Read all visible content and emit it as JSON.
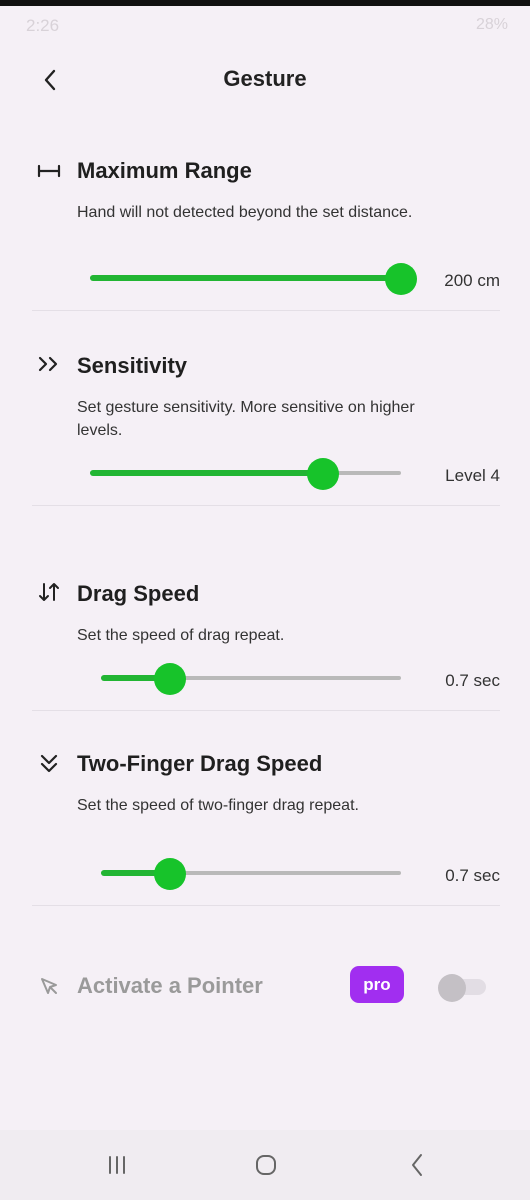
{
  "status_bar": {
    "time": "2:26",
    "right_text": "28%"
  },
  "header": {
    "title": "Gesture"
  },
  "sections": [
    {
      "title": "Maximum Range",
      "description": "Hand will not detected beyond the set distance.",
      "value_label": "200 cm",
      "level": 1.0
    },
    {
      "title": "Sensitivity",
      "description": "Set gesture sensitivity. More sensitive on higher levels.",
      "value_label": "Level 4",
      "level": 0.75
    },
    {
      "title": "Drag Speed",
      "description": "Set the speed of drag repeat.",
      "value_label": "0.7 sec",
      "level": 0.23
    },
    {
      "title": "Two-Finger Drag Speed",
      "description": "Set the speed of two-finger drag repeat.",
      "value_label": "0.7 sec",
      "level": 0.23
    }
  ],
  "pointer": {
    "title": "Activate a Pointer",
    "badge": "pro",
    "enabled": false
  },
  "icons": {
    "back": "chevron-left-icon",
    "range": "horizontal-range-icon",
    "sensitivity": "double-chevron-right-icon",
    "drag": "up-down-arrows-icon",
    "two_finger": "double-chevron-down-icon",
    "pointer": "cursor-icon"
  },
  "colors": {
    "accent": "#17c32a",
    "pro": "#a12ef0",
    "background": "#f5f0f6"
  }
}
